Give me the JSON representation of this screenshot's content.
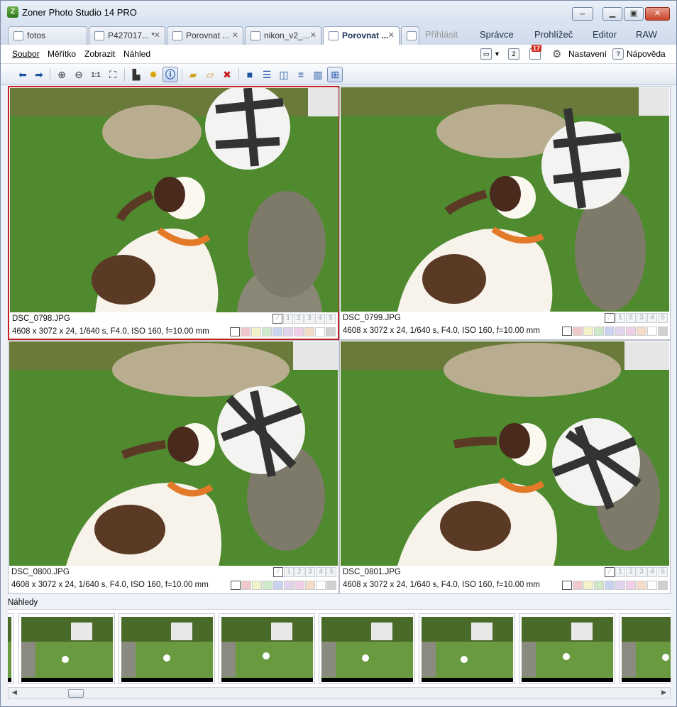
{
  "window": {
    "title": "Zoner Photo Studio 14 PRO",
    "icon_letter": "Z"
  },
  "tabs": [
    {
      "label": "fotos",
      "closable": false
    },
    {
      "label": "P427017... *",
      "closable": true
    },
    {
      "label": "Porovnat ...",
      "closable": true
    },
    {
      "label": "nikon_v2_...",
      "closable": true
    },
    {
      "label": "Porovnat ...",
      "closable": true,
      "active": true
    }
  ],
  "modes": {
    "login": "Přihlásit",
    "manager": "Správce",
    "viewer": "Prohlížeč",
    "editor": "Editor",
    "raw": "RAW"
  },
  "menu": {
    "file": "Soubor",
    "scale": "Měřítko",
    "view": "Zobrazit",
    "preview": "Náhled",
    "settings": "Nastavení",
    "help": "Nápověda",
    "badge": "17"
  },
  "images": [
    {
      "file": "DSC_0798.JPG",
      "meta": "4608 x 3072 x 24, 1/640 s, F4.0, ISO 160, f=10.00 mm",
      "selected": true
    },
    {
      "file": "DSC_0799.JPG",
      "meta": "4608 x 3072 x 24, 1/640 s, F4.0, ISO 160, f=10.00 mm",
      "selected": false
    },
    {
      "file": "DSC_0800.JPG",
      "meta": "4608 x 3072 x 24, 1/640 s, F4.0, ISO 160, f=10.00 mm",
      "selected": false
    },
    {
      "file": "DSC_0801.JPG",
      "meta": "4608 x 3072 x 24, 1/640 s, F4.0, ISO 160, f=10.00 mm",
      "selected": false
    }
  ],
  "rating_labels": [
    "1",
    "2",
    "3",
    "4",
    "5"
  ],
  "label_colors": [
    "#f0c8cc",
    "#f4f2c8",
    "#cfe8c9",
    "#c9d3f0",
    "#e2d3ec",
    "#f2cfe8",
    "#f3ddc8",
    "#ffffff",
    "#d0d0d0"
  ],
  "thumbnails": {
    "header": "Náhledy"
  },
  "colors": {
    "selection": "#c21f25",
    "accent": "#1f52a3"
  }
}
